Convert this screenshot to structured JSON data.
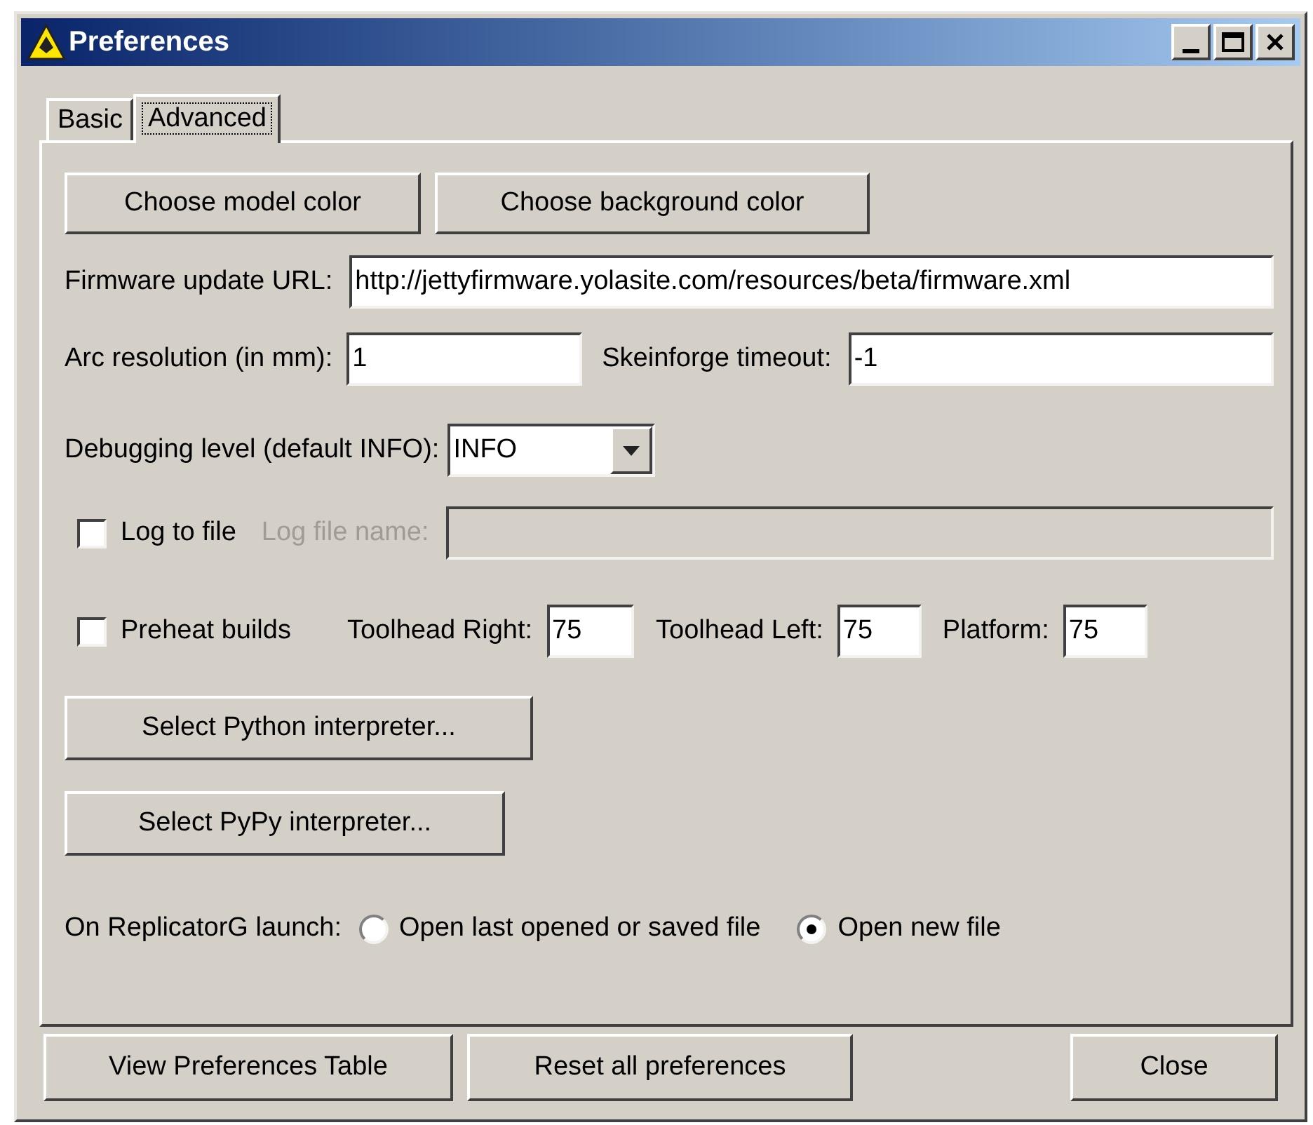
{
  "window": {
    "title": "Preferences"
  },
  "tabs": [
    {
      "label": "Basic",
      "selected": false
    },
    {
      "label": "Advanced",
      "selected": true
    }
  ],
  "color_buttons": [
    "Choose model color",
    "Choose background color"
  ],
  "firmware_url": {
    "label": "Firmware update URL:",
    "value": "http://jettyfirmware.yolasite.com/resources/beta/firmware.xml"
  },
  "arc_resolution": {
    "label": "Arc resolution (in mm):",
    "value": "1"
  },
  "skeinforge_timeout": {
    "label": "Skeinforge timeout:",
    "value": "-1"
  },
  "debugging_level": {
    "label": "Debugging level (default INFO):",
    "value": "INFO"
  },
  "log": {
    "label": "Log to file",
    "checked": false,
    "file_label": "Log file name:",
    "file_disabled": true
  },
  "preheat": {
    "label": "Preheat builds",
    "checked": false,
    "temps": [
      {
        "label": "Toolhead Right:",
        "value": "75"
      },
      {
        "label": "Toolhead Left:",
        "value": "75"
      },
      {
        "label": "Platform:",
        "value": "75"
      }
    ]
  },
  "interpreter_buttons": [
    "Select Python interpreter...",
    "Select PyPy interpreter..."
  ],
  "launch": {
    "label": "On ReplicatorG launch:",
    "options": [
      {
        "label": "Open last opened or saved file",
        "selected": false
      },
      {
        "label": "Open new file",
        "selected": true
      }
    ]
  },
  "footer": {
    "left": [
      "View Preferences Table",
      "Reset all preferences"
    ],
    "right": [
      "Close"
    ]
  }
}
